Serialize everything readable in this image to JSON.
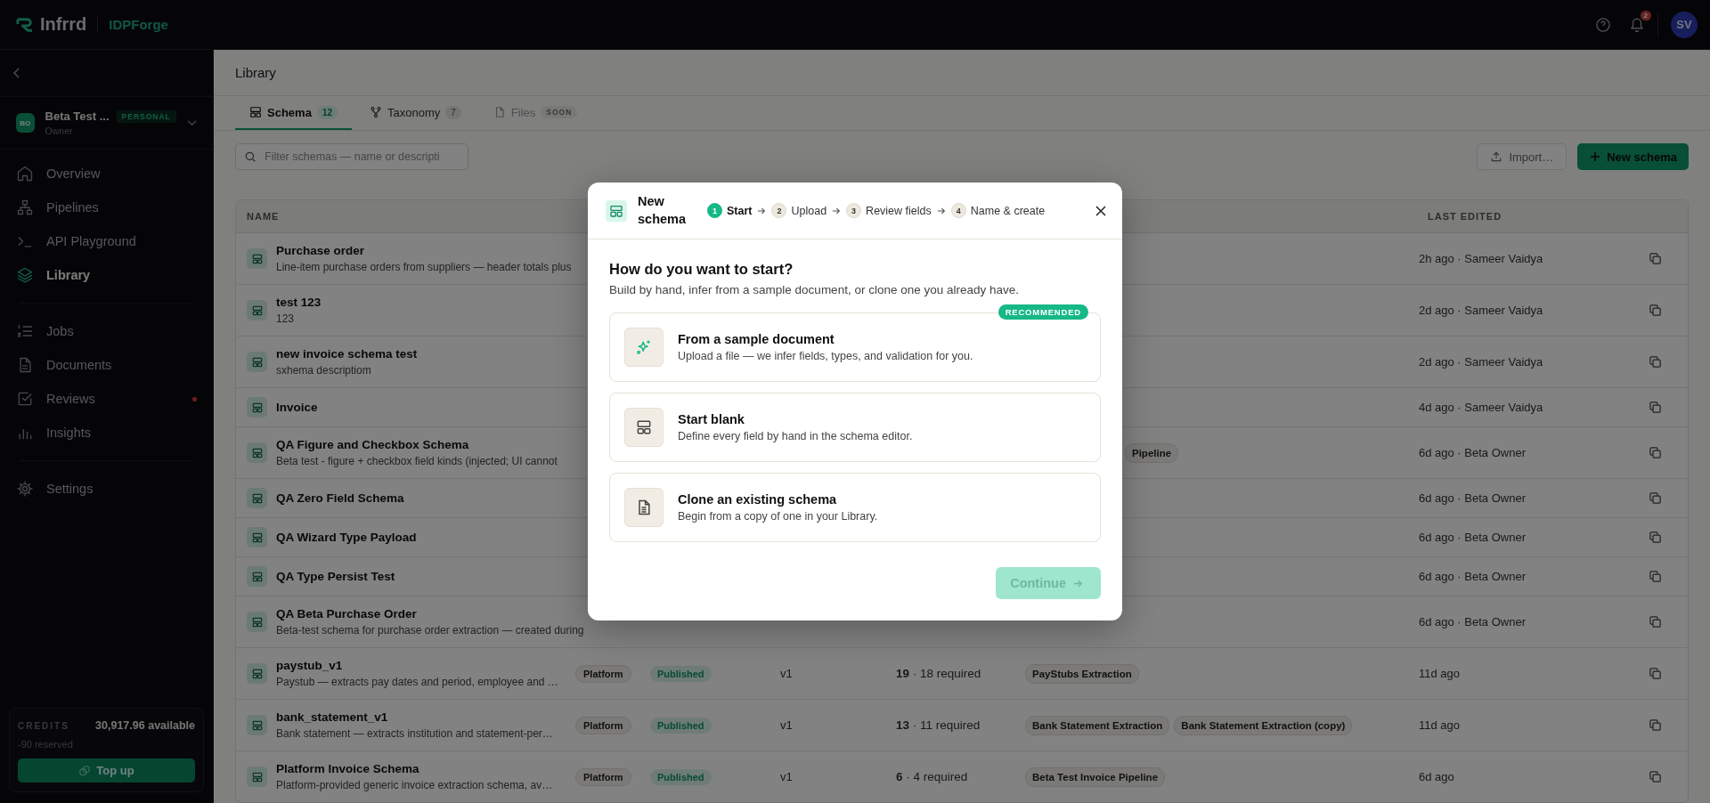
{
  "topbar": {
    "brand": "Infrrd",
    "product": "IDPForge",
    "notifications": "2",
    "avatar": "SV"
  },
  "sidebar": {
    "workspace": {
      "avatar": "BO",
      "name": "Beta Test ...",
      "badge": "PERSONAL",
      "role": "Owner"
    },
    "groups": [
      [
        {
          "label": "Overview",
          "selected": false,
          "alert": false
        },
        {
          "label": "Pipelines",
          "selected": false,
          "alert": false
        },
        {
          "label": "API Playground",
          "selected": false,
          "alert": false
        },
        {
          "label": "Library",
          "selected": true,
          "alert": false
        }
      ],
      [
        {
          "label": "Jobs",
          "selected": false,
          "alert": false
        },
        {
          "label": "Documents",
          "selected": false,
          "alert": false
        },
        {
          "label": "Reviews",
          "selected": false,
          "alert": true
        },
        {
          "label": "Insights",
          "selected": false,
          "alert": false
        }
      ],
      [
        {
          "label": "Settings",
          "selected": false,
          "alert": false
        }
      ]
    ],
    "credits": {
      "label": "CREDITS",
      "available": "30,917.96 available",
      "reserved": "-90 reserved",
      "button": "Top up"
    }
  },
  "page": {
    "title": "Library",
    "tabs": [
      {
        "label": "Schema",
        "count": "12",
        "selected": true,
        "disabled": false
      },
      {
        "label": "Taxonomy",
        "count": "7",
        "selected": false,
        "disabled": false
      },
      {
        "label": "Files",
        "count": "SOON",
        "selected": false,
        "disabled": true
      }
    ],
    "filter": {
      "placeholder": "Filter schemas — name or descripti"
    },
    "actions": [
      {
        "label": "Import…",
        "kind": "secondary"
      },
      {
        "label": "New schema",
        "kind": "primary"
      }
    ]
  },
  "table": {
    "columns": [
      "NAME",
      "LAST EDITED"
    ],
    "rows": [
      {
        "name": "Purchase order",
        "description": "Line-item purchase orders from suppliers — header totals plus",
        "last_edited": "2h ago · Sameer Vaidya"
      },
      {
        "name": "test 123",
        "description": "123",
        "last_edited": "2d ago · Sameer Vaidya"
      },
      {
        "name": "new invoice schema test",
        "description": "sxhema descriptiom",
        "last_edited": "2d ago · Sameer Vaidya"
      },
      {
        "name": "Invoice",
        "last_edited": "4d ago · Sameer Vaidya"
      },
      {
        "name": "QA Figure and Checkbox Schema",
        "description": "Beta test - figure + checkbox field kinds (injected; UI cannot",
        "pipeline_fragment": "Pipeline",
        "last_edited": "6d ago · Beta Owner"
      },
      {
        "name": "QA Zero Field Schema",
        "last_edited": "6d ago · Beta Owner"
      },
      {
        "name": "QA Wizard Type Payload",
        "last_edited": "6d ago · Beta Owner"
      },
      {
        "name": "QA Type Persist Test",
        "last_edited": "6d ago · Beta Owner"
      },
      {
        "name": "QA Beta Purchase Order",
        "description": "Beta-test schema for purchase order extraction — created during",
        "last_edited": "6d ago · Beta Owner"
      },
      {
        "name": "paystub_v1",
        "description": "Paystub — extracts pay dates and period, employee and …",
        "source": "Platform",
        "status": "Published",
        "version": "v1",
        "fields": "**19** · 18 required",
        "pipelines": [
          "PayStubs Extraction"
        ],
        "last_edited": "11d ago"
      },
      {
        "name": "bank_statement_v1",
        "description": "Bank statement — extracts institution and statement-per…",
        "source": "Platform",
        "status": "Published",
        "version": "v1",
        "fields": "**13** · 11 required",
        "pipelines": [
          "Bank Statement Extraction",
          "Bank Statement Extraction (copy)"
        ],
        "last_edited": "11d ago"
      },
      {
        "name": "Platform Invoice Schema",
        "description": "Platform-provided generic invoice extraction schema, av…",
        "source": "Platform",
        "status": "Published",
        "version": "v1",
        "fields": "**6** · 4 required",
        "pipelines": [
          "Beta Test Invoice Pipeline"
        ],
        "last_edited": "6d ago"
      }
    ]
  },
  "modal": {
    "title": "New schema",
    "steps": [
      {
        "number": "1",
        "label": "Start",
        "selected": true
      },
      {
        "number": "2",
        "label": "Upload",
        "selected": false
      },
      {
        "number": "3",
        "label": "Review fields",
        "selected": false
      },
      {
        "number": "4",
        "label": "Name & create",
        "selected": false
      }
    ],
    "heading": "How do you want to start?",
    "subtitle": "Build by hand, infer from a sample document, or clone one you already have.",
    "options": [
      {
        "title": "From a sample document",
        "description": "Upload a file — we infer fields, types, and validation for you.",
        "badge": "RECOMMENDED"
      },
      {
        "title": "Start blank",
        "description": "Define every field by hand in the schema editor."
      },
      {
        "title": "Clone an existing schema",
        "description": "Begin from a copy of one in your Library."
      }
    ],
    "continue": {
      "label": "Continue",
      "disabled": true
    }
  }
}
